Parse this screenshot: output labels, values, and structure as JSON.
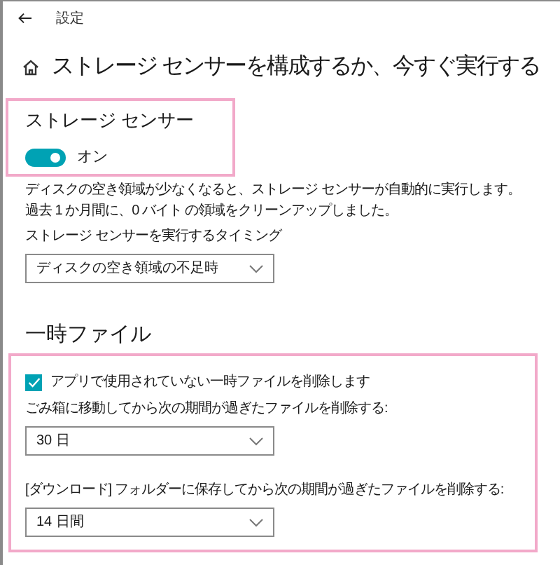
{
  "window": {
    "title": "設定"
  },
  "page": {
    "title": "ストレージ センサーを構成するか、今すぐ実行する"
  },
  "storage_sense": {
    "highlighted": true,
    "heading": "ストレージ センサー",
    "toggle": {
      "on": true,
      "label": "オン"
    },
    "description": "ディスクの空き領域が少なくなると、ストレージ センサーが自動的に実行します。過去 1 か月間に、0 バイト の領域をクリーンアップしました。",
    "timing_label": "ストレージ センサーを実行するタイミング",
    "timing_dropdown": {
      "value": "ディスクの空き領域の不足時"
    }
  },
  "temp_files": {
    "highlighted": true,
    "heading": "一時ファイル",
    "checkbox": {
      "label": "アプリで使用されていない一時ファイルを削除します",
      "checked": true
    },
    "recycle_label": "ごみ箱に移動してから次の期間が過ぎたファイルを削除する:",
    "recycle_dropdown": {
      "value": "30 日"
    },
    "downloads_label": "[ダウンロード] フォルダーに保存してから次の期間が過ぎたファイルを削除する:",
    "downloads_dropdown": {
      "value": "14 日間"
    }
  }
}
